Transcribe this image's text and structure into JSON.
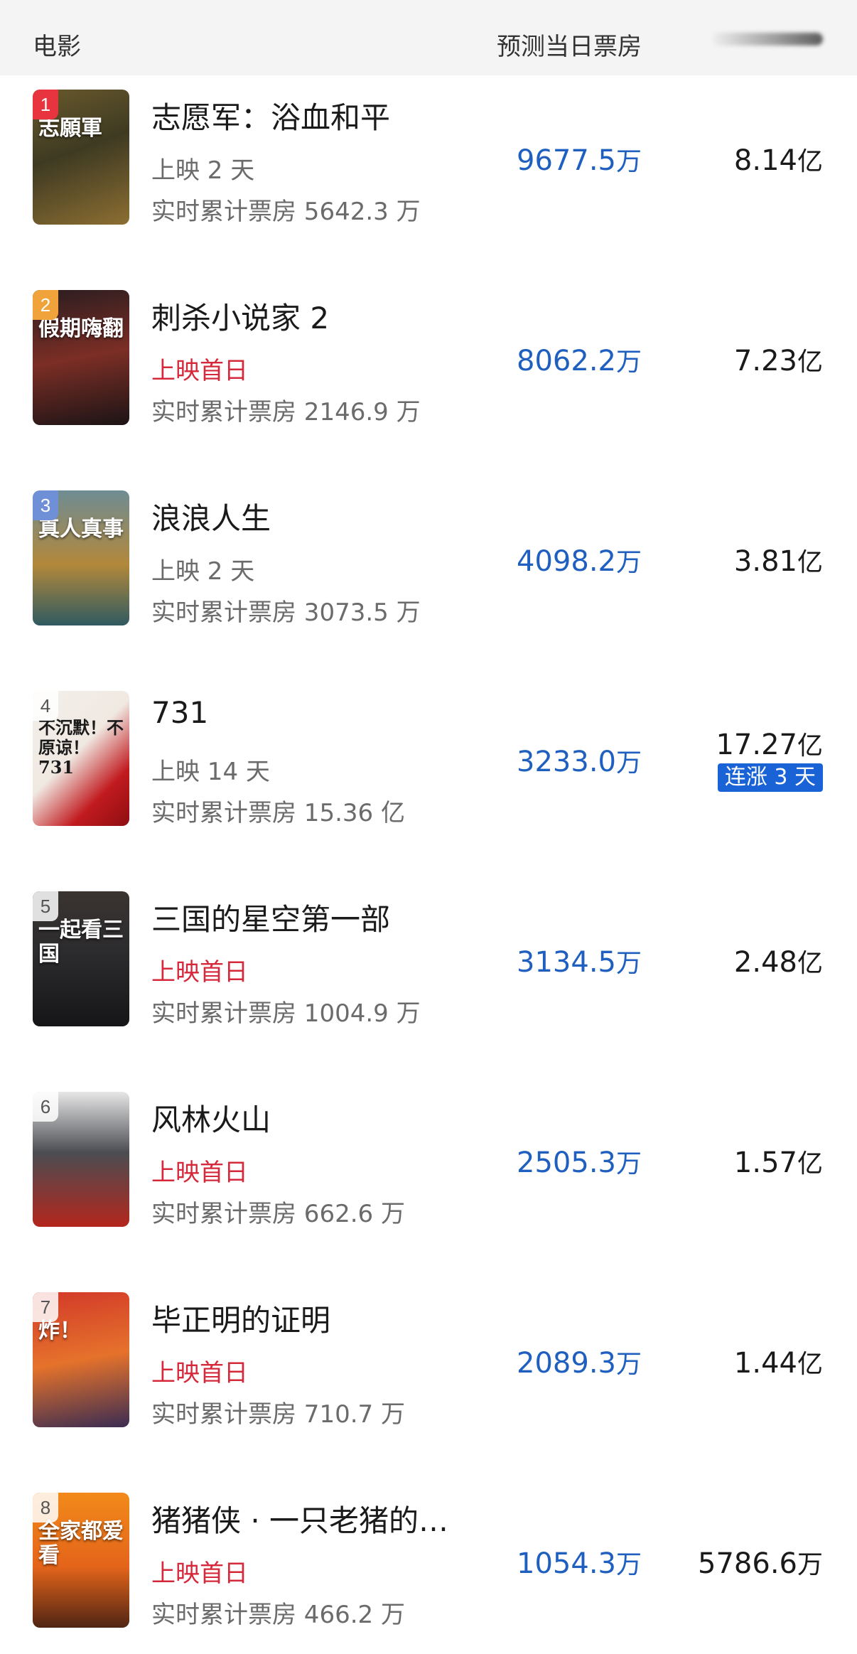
{
  "header": {
    "movie_label": "电影",
    "forecast_label": "预测当日票房"
  },
  "movies": [
    {
      "rank": "1",
      "title": "志愿军：浴血和平",
      "poster_text": "志願軍",
      "days": "上映 2 天",
      "cumulative": "实时累计票房 5642.3 万",
      "forecast_value": "9677.5",
      "forecast_unit": "万",
      "total_value": "8.14",
      "total_unit": "亿"
    },
    {
      "rank": "2",
      "title": "刺杀小说家 2",
      "poster_text": "假期嗨翻",
      "days": "上映首日",
      "cumulative": "实时累计票房 2146.9 万",
      "forecast_value": "8062.2",
      "forecast_unit": "万",
      "total_value": "7.23",
      "total_unit": "亿"
    },
    {
      "rank": "3",
      "title": "浪浪人生",
      "poster_text": "真人真事",
      "days": "上映 2 天",
      "cumulative": "实时累计票房 3073.5 万",
      "forecast_value": "4098.2",
      "forecast_unit": "万",
      "total_value": "3.81",
      "total_unit": "亿"
    },
    {
      "rank": "4",
      "title": "731",
      "poster_text": "不沉默！不原谅！731",
      "days": "上映 14 天",
      "cumulative": "实时累计票房 15.36 亿",
      "forecast_value": "3233.0",
      "forecast_unit": "万",
      "total_value": "17.27",
      "total_unit": "亿",
      "badge": "连涨 3 天"
    },
    {
      "rank": "5",
      "title": "三国的星空第一部",
      "poster_text": "一起看三国",
      "days": "上映首日",
      "cumulative": "实时累计票房 1004.9 万",
      "forecast_value": "3134.5",
      "forecast_unit": "万",
      "total_value": "2.48",
      "total_unit": "亿"
    },
    {
      "rank": "6",
      "title": "风林火山",
      "poster_text": "",
      "days": "上映首日",
      "cumulative": "实时累计票房 662.6 万",
      "forecast_value": "2505.3",
      "forecast_unit": "万",
      "total_value": "1.57",
      "total_unit": "亿"
    },
    {
      "rank": "7",
      "title": "毕正明的证明",
      "poster_text": "炸！",
      "days": "上映首日",
      "cumulative": "实时累计票房 710.7 万",
      "forecast_value": "2089.3",
      "forecast_unit": "万",
      "total_value": "1.44",
      "total_unit": "亿"
    },
    {
      "rank": "8",
      "title": "猪猪侠 · 一只老猪的…",
      "poster_text": "全家都爱看",
      "days": "上映首日",
      "cumulative": "实时累计票房 466.2 万",
      "forecast_value": "1054.3",
      "forecast_unit": "万",
      "total_value": "5786.6",
      "total_unit": "万"
    }
  ],
  "colors": {
    "accent_blue": "#1f5fbf",
    "first_day_red": "#d5283a",
    "badge_blue": "#1a63d6"
  }
}
